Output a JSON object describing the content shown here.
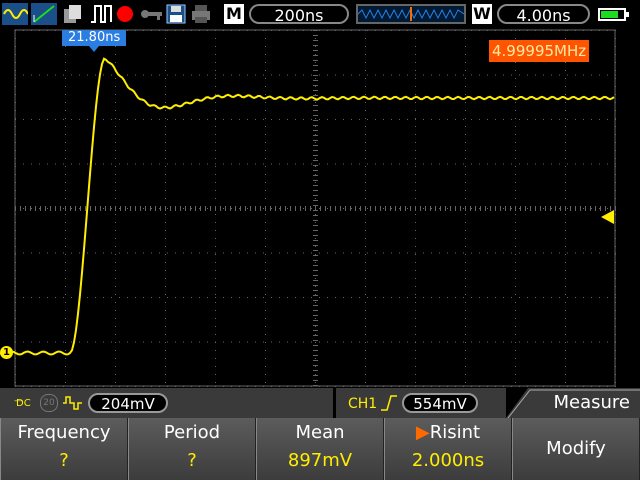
{
  "topbar": {
    "mode_letter": "M",
    "timebase": "200ns",
    "window_letter": "W",
    "window_timebase": "4.00ns",
    "battery_level_fraction": 0.75
  },
  "screen": {
    "trigger_time": "21.80ns",
    "frequency_readout": "4.99995MHz",
    "channel_marker": "1"
  },
  "infobar": {
    "coupling": "DC",
    "bw_limit": "20",
    "volts_per_div": "204mV",
    "trigger_source": "CH1",
    "trigger_level": "554mV",
    "menu_title": "Measure"
  },
  "menu": {
    "buttons": [
      {
        "label": "Frequency",
        "value": "?"
      },
      {
        "label": "Period",
        "value": "?"
      },
      {
        "label": "Mean",
        "value": "897mV"
      },
      {
        "label": "Risint",
        "value": "2.000ns"
      }
    ],
    "modify_label": "Modify"
  },
  "colors": {
    "trace": "#ffee00",
    "grid": "#666666",
    "trigger_badge": "#2a7de1",
    "frequency_badge": "#ff5500"
  }
}
